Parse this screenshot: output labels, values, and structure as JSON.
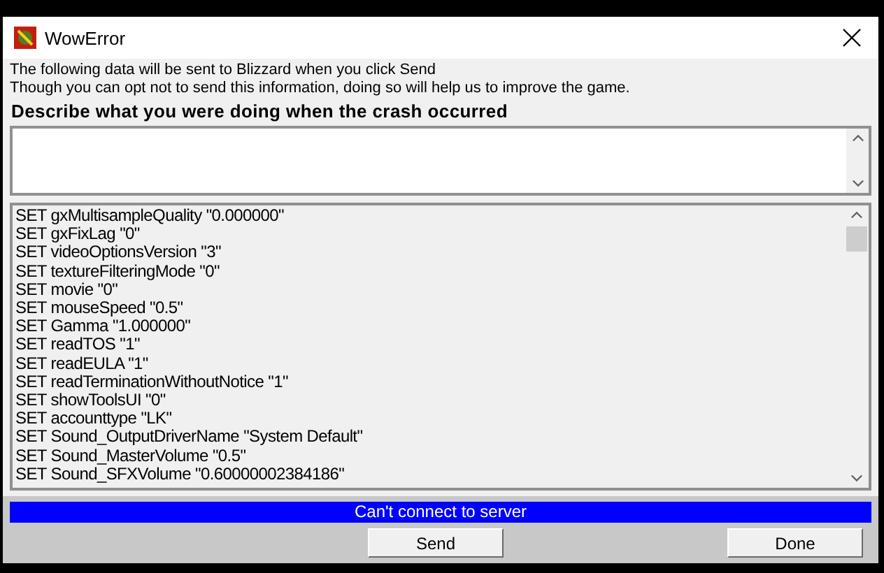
{
  "window": {
    "title": "WowError"
  },
  "intro": [
    "The following data will be sent to Blizzard when you click Send",
    "Though you can opt not to send this information, doing so will help us to improve the game."
  ],
  "description": {
    "label": "Describe what you were doing when the crash occurred"
  },
  "log": [
    "SET gxMultisampleQuality \"0.000000\"",
    "SET gxFixLag \"0\"",
    "SET videoOptionsVersion \"3\"",
    "SET textureFilteringMode \"0\"",
    "SET movie \"0\"",
    "SET mouseSpeed \"0.5\"",
    "SET Gamma \"1.000000\"",
    "SET readTOS \"1\"",
    "SET readEULA \"1\"",
    "SET readTerminationWithoutNotice \"1\"",
    "SET showToolsUI \"0\"",
    "SET accounttype \"LK\"",
    "SET Sound_OutputDriverName \"System Default\"",
    "SET Sound_MasterVolume \"0.5\"",
    "SET Sound_SFXVolume \"0.60000002384186\""
  ],
  "status": "Can't connect to server",
  "buttons": [
    "Send",
    "Done"
  ]
}
